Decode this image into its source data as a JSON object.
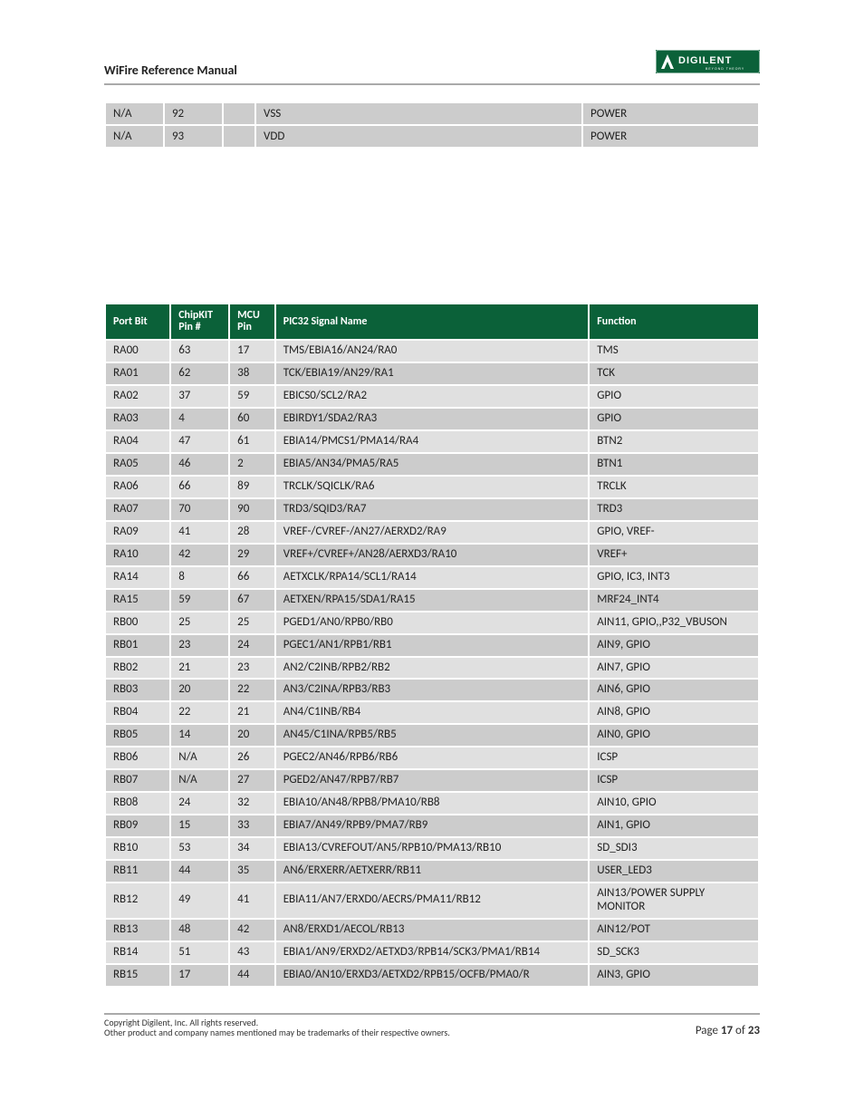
{
  "header": {
    "title": "WiFire Reference Manual",
    "logo_text_main": "DIGILENT",
    "logo_text_sub": "BEYOND THEORY"
  },
  "top_table_rows": [
    {
      "c0": "N/A",
      "c1": "92",
      "c2": "",
      "c3": "VSS",
      "c4": "POWER"
    },
    {
      "c0": "N/A",
      "c1": "93",
      "c2": "",
      "c3": "VDD",
      "c4": "POWER"
    }
  ],
  "main_table": {
    "headers": {
      "port_bit": "Port Bit",
      "chipkit_pin": "ChipKIT Pin #",
      "mcu_pin": "MCU Pin",
      "signal": "PIC32 Signal Name",
      "function": "Function"
    },
    "rows": [
      {
        "port_bit": "RA00",
        "chipkit_pin": "63",
        "mcu_pin": "17",
        "signal": "TMS/EBIA16/AN24/RA0",
        "function": "TMS"
      },
      {
        "port_bit": "RA01",
        "chipkit_pin": "62",
        "mcu_pin": "38",
        "signal": "TCK/EBIA19/AN29/RA1",
        "function": "TCK"
      },
      {
        "port_bit": "RA02",
        "chipkit_pin": "37",
        "mcu_pin": "59",
        "signal": "EBICS0/SCL2/RA2",
        "function": "GPIO"
      },
      {
        "port_bit": "RA03",
        "chipkit_pin": "4",
        "mcu_pin": "60",
        "signal": "EBIRDY1/SDA2/RA3",
        "function": "GPIO"
      },
      {
        "port_bit": "RA04",
        "chipkit_pin": "47",
        "mcu_pin": "61",
        "signal": "EBIA14/PMCS1/PMA14/RA4",
        "function": "BTN2"
      },
      {
        "port_bit": "RA05",
        "chipkit_pin": "46",
        "mcu_pin": "2",
        "signal": "EBIA5/AN34/PMA5/RA5",
        "function": "BTN1"
      },
      {
        "port_bit": "RA06",
        "chipkit_pin": "66",
        "mcu_pin": "89",
        "signal": "TRCLK/SQICLK/RA6",
        "function": "TRCLK"
      },
      {
        "port_bit": "RA07",
        "chipkit_pin": "70",
        "mcu_pin": "90",
        "signal": "TRD3/SQID3/RA7",
        "function": "TRD3"
      },
      {
        "port_bit": "RA09",
        "chipkit_pin": "41",
        "mcu_pin": "28",
        "signal": "VREF-/CVREF-/AN27/AERXD2/RA9",
        "function": "GPIO, VREF-"
      },
      {
        "port_bit": "RA10",
        "chipkit_pin": "42",
        "mcu_pin": "29",
        "signal": "VREF+/CVREF+/AN28/AERXD3/RA10",
        "function": "VREF+"
      },
      {
        "port_bit": "RA14",
        "chipkit_pin": "8",
        "mcu_pin": "66",
        "signal": "AETXCLK/RPA14/SCL1/RA14",
        "function": "GPIO, IC3, INT3"
      },
      {
        "port_bit": "RA15",
        "chipkit_pin": "59",
        "mcu_pin": "67",
        "signal": "AETXEN/RPA15/SDA1/RA15",
        "function": "MRF24_INT4"
      },
      {
        "port_bit": "RB00",
        "chipkit_pin": "25",
        "mcu_pin": "25",
        "signal": "PGED1/AN0/RPB0/RB0",
        "function": "AIN11, GPIO,,P32_VBUSON"
      },
      {
        "port_bit": "RB01",
        "chipkit_pin": "23",
        "mcu_pin": "24",
        "signal": "PGEC1/AN1/RPB1/RB1",
        "function": "AIN9, GPIO"
      },
      {
        "port_bit": "RB02",
        "chipkit_pin": "21",
        "mcu_pin": "23",
        "signal": "AN2/C2INB/RPB2/RB2",
        "function": "AIN7, GPIO"
      },
      {
        "port_bit": "RB03",
        "chipkit_pin": "20",
        "mcu_pin": "22",
        "signal": "AN3/C2INA/RPB3/RB3",
        "function": "AIN6, GPIO"
      },
      {
        "port_bit": "RB04",
        "chipkit_pin": "22",
        "mcu_pin": "21",
        "signal": "AN4/C1INB/RB4",
        "function": "AIN8, GPIO"
      },
      {
        "port_bit": "RB05",
        "chipkit_pin": "14",
        "mcu_pin": "20",
        "signal": "AN45/C1INA/RPB5/RB5",
        "function": "AIN0, GPIO"
      },
      {
        "port_bit": "RB06",
        "chipkit_pin": "N/A",
        "mcu_pin": "26",
        "signal": "PGEC2/AN46/RPB6/RB6",
        "function": "ICSP"
      },
      {
        "port_bit": "RB07",
        "chipkit_pin": "N/A",
        "mcu_pin": "27",
        "signal": "PGED2/AN47/RPB7/RB7",
        "function": "ICSP"
      },
      {
        "port_bit": "RB08",
        "chipkit_pin": "24",
        "mcu_pin": "32",
        "signal": "EBIA10/AN48/RPB8/PMA10/RB8",
        "function": "AIN10, GPIO"
      },
      {
        "port_bit": "RB09",
        "chipkit_pin": "15",
        "mcu_pin": "33",
        "signal": "EBIA7/AN49/RPB9/PMA7/RB9",
        "function": "AIN1, GPIO"
      },
      {
        "port_bit": "RB10",
        "chipkit_pin": "53",
        "mcu_pin": "34",
        "signal": "EBIA13/CVREFOUT/AN5/RPB10/PMA13/RB10",
        "function": "SD_SDI3"
      },
      {
        "port_bit": "RB11",
        "chipkit_pin": "44",
        "mcu_pin": "35",
        "signal": "AN6/ERXERR/AETXERR/RB11",
        "function": "USER_LED3"
      },
      {
        "port_bit": "RB12",
        "chipkit_pin": "49",
        "mcu_pin": "41",
        "signal": "EBIA11/AN7/ERXD0/AECRS/PMA11/RB12",
        "function": "AIN13/POWER SUPPLY MONITOR"
      },
      {
        "port_bit": "RB13",
        "chipkit_pin": "48",
        "mcu_pin": "42",
        "signal": "AN8/ERXD1/AECOL/RB13",
        "function": "AIN12/POT"
      },
      {
        "port_bit": "RB14",
        "chipkit_pin": "51",
        "mcu_pin": "43",
        "signal": "EBIA1/AN9/ERXD2/AETXD3/RPB14/SCK3/PMA1/RB14",
        "function": "SD_SCK3"
      },
      {
        "port_bit": "RB15",
        "chipkit_pin": "17",
        "mcu_pin": "44",
        "signal": "EBIA0/AN10/ERXD3/AETXD2/RPB15/OCFB/PMA0/R",
        "function": "AIN3, GPIO"
      }
    ]
  },
  "footer": {
    "copyright": "Copyright Digilent, Inc. All rights reserved.",
    "trademark": "Other product and company names mentioned may be trademarks of their respective owners.",
    "page_label": "Page ",
    "page_num": "17",
    "page_of": " of ",
    "page_total": "23"
  }
}
